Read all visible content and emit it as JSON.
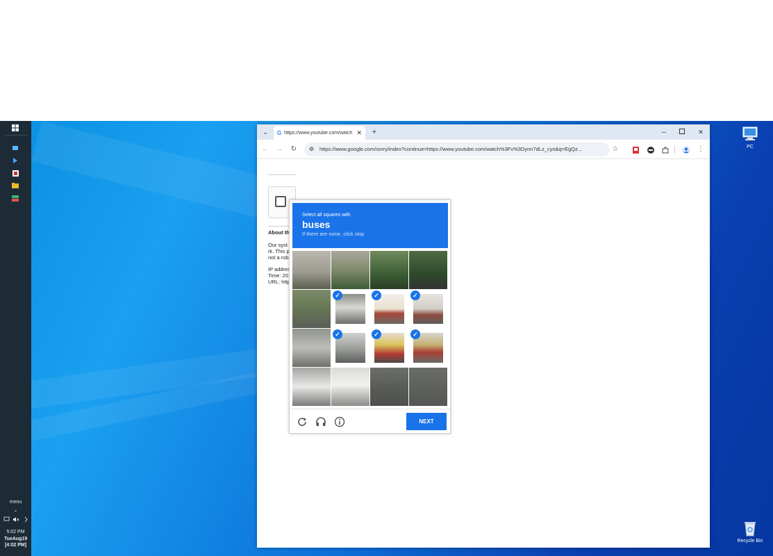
{
  "browser": {
    "tab_title": "https://www.youtube.com/watch",
    "new_tab": "+",
    "url": "https://www.google.com/sorry/index?continue=https://www.youtube.com/watch%3Fv%3Dynn7dLz_cyo&q=EgQz..."
  },
  "underlying_page": {
    "about_heading": "About th",
    "lines": [
      "Our syst",
      "rk. This p",
      "not a rob",
      "",
      "IP addres",
      "Time: 20",
      "URL: http"
    ]
  },
  "captcha": {
    "instruction": "Select all squares with",
    "target": "buses",
    "hint": "If there are none, click skip",
    "next_label": "NEXT",
    "selected_cells": [
      5,
      6,
      7,
      9,
      10,
      11
    ],
    "icons": [
      "reload-icon",
      "headphones-icon",
      "info-icon"
    ]
  },
  "taskbar": {
    "menu_label": "menu",
    "time": "5:02 PM",
    "date": "TueAug19",
    "alt_time": "[4:02 PM]"
  },
  "desktop": {
    "icons": [
      {
        "name": "pc-icon",
        "label": "PC"
      },
      {
        "name": "recycle-bin-icon",
        "label": "Recycle Bin"
      }
    ]
  },
  "colors": {
    "accent": "#1a73e8",
    "taskbar": "#1d2b36"
  }
}
